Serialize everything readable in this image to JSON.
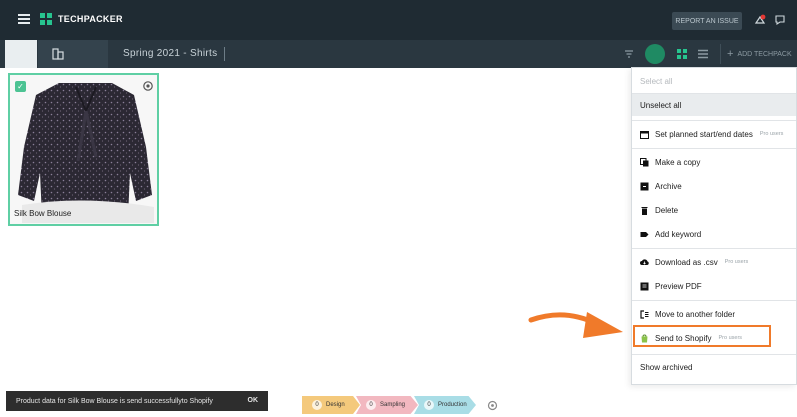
{
  "app": {
    "logo_text": "TECHPACKER"
  },
  "header": {
    "report_label": "REPORT AN ISSUE"
  },
  "subbar": {
    "title": "Spring 2021 - Shirts",
    "add_label": "ADD TECHPACK",
    "add_symbol": "+"
  },
  "product": {
    "name": "Silk Bow Blouse",
    "checkmark": "✓"
  },
  "menu": {
    "items": [
      {
        "label": "Select all",
        "pro": ""
      },
      {
        "label": "Unselect all",
        "pro": ""
      },
      {
        "label": "Set planned start/end dates",
        "pro": "Pro users",
        "icon": "calendar-icon"
      },
      {
        "label": "Make a copy",
        "pro": "",
        "icon": "copy-icon"
      },
      {
        "label": "Archive",
        "pro": "",
        "icon": "archive-icon"
      },
      {
        "label": "Delete",
        "pro": "",
        "icon": "trash-icon"
      },
      {
        "label": "Add keyword",
        "pro": "",
        "icon": "tag-icon"
      },
      {
        "label": "Download as .csv",
        "pro": "Pro users",
        "icon": "cloud-download-icon"
      },
      {
        "label": "Preview PDF",
        "pro": "",
        "icon": "pdf-icon"
      },
      {
        "label": "Move to another folder",
        "pro": "",
        "icon": "move-folder-icon"
      },
      {
        "label": "Send to Shopify",
        "pro": "Pro users",
        "icon": "shopify-icon"
      },
      {
        "label": "Show archived",
        "pro": ""
      }
    ]
  },
  "toast": {
    "message": "Product data for Silk Bow Blouse is send successfullyto Shopify",
    "ok_label": "OK"
  },
  "stages": [
    {
      "label": "Design",
      "count": "0"
    },
    {
      "label": "Sampling",
      "count": "0"
    },
    {
      "label": "Production",
      "count": "0"
    }
  ],
  "colors": {
    "accent": "#27c48f",
    "highlight": "#f07a2a",
    "topbar": "#1f2b33"
  }
}
